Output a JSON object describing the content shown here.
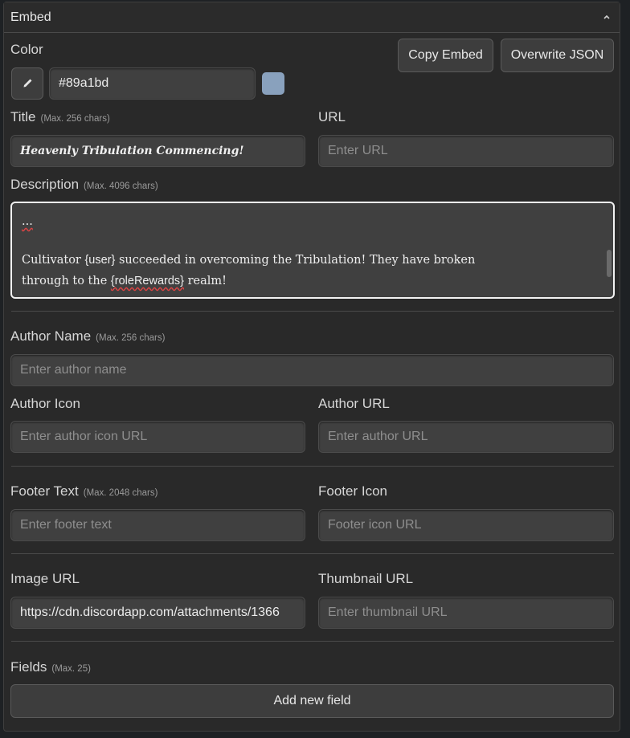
{
  "panel": {
    "title": "Embed"
  },
  "color": {
    "label": "Color",
    "value": "#89a1bd",
    "swatch": "#89a1bd"
  },
  "actions": {
    "copy_label": "Copy Embed",
    "overwrite_label": "Overwrite JSON"
  },
  "title_field": {
    "label": "Title",
    "hint": "(Max. 256 chars)",
    "value": "Heavenly Tribulation Commencing!"
  },
  "url_field": {
    "label": "URL",
    "placeholder": "Enter URL"
  },
  "description": {
    "label": "Description",
    "hint": "(Max. 4096 chars)",
    "line1": "...",
    "line2_pre": "Cultivator ",
    "line2_user": "{user}",
    "line2_post": " succeeded in overcoming the Tribulation! They have broken",
    "line3_pre": "through to the ",
    "line3_role": "{roleRewards}",
    "line3_post": " realm!"
  },
  "author_name": {
    "label": "Author Name",
    "hint": "(Max. 256 chars)",
    "placeholder": "Enter author name"
  },
  "author_icon": {
    "label": "Author Icon",
    "placeholder": "Enter author icon URL"
  },
  "author_url": {
    "label": "Author URL",
    "placeholder": "Enter author URL"
  },
  "footer_text": {
    "label": "Footer Text",
    "hint": "(Max. 2048 chars)",
    "placeholder": "Enter footer text"
  },
  "footer_icon": {
    "label": "Footer Icon",
    "placeholder": "Footer icon URL"
  },
  "image_url": {
    "label": "Image URL",
    "value": "https://cdn.discordapp.com/attachments/1366"
  },
  "thumbnail_url": {
    "label": "Thumbnail URL",
    "placeholder": "Enter thumbnail URL"
  },
  "fields": {
    "label": "Fields",
    "hint": "(Max. 25)",
    "add_label": "Add new field"
  },
  "icons": {
    "collapse": "chevron-up-icon",
    "picker": "eyedropper-icon"
  }
}
